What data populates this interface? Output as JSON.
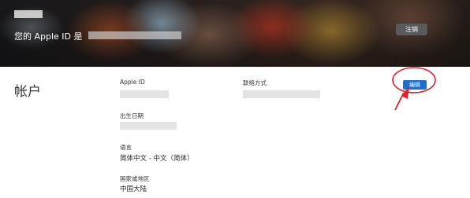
{
  "header": {
    "apple_id_prefix": "您的 Apple ID 是",
    "logout_label": "注销"
  },
  "account": {
    "title": "帐户",
    "apple_id_label": "Apple ID",
    "contact_label": "联络方式",
    "birth_label": "出生日期",
    "language_label": "语言",
    "language_value": "简体中文 - 中文（简体）",
    "region_label": "国家或地区",
    "region_value": "中国大陆",
    "edit_label": "编辑"
  },
  "colors": {
    "accent": "#1a6fd1",
    "annotation": "#e0202a"
  }
}
